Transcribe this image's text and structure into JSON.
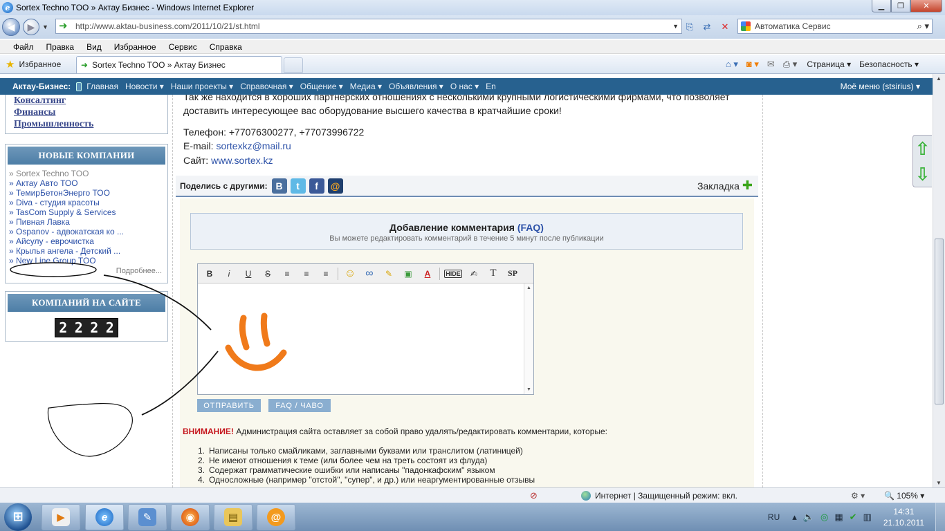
{
  "window": {
    "title": "Sortex Techno TOO » Актау Бизнес - Windows Internet Explorer",
    "min": "▁",
    "max": "❐",
    "close": "✕"
  },
  "address": {
    "url": "http://www.aktau-business.com/2011/10/21/st.html",
    "search_text": "Автоматика Сервис"
  },
  "menu": [
    "Файл",
    "Правка",
    "Вид",
    "Избранное",
    "Сервис",
    "Справка"
  ],
  "favorites": {
    "label": "Избранное",
    "tab_title": "Sortex Techno TOO » Актау Бизнес",
    "page_menu": "Страница ▾",
    "safety_menu": "Безопасность ▾"
  },
  "site_nav": {
    "brand": "Актау-Бизнес:",
    "items": [
      "Главная",
      "Новости ▾",
      "Наши проекты ▾",
      "Справочная ▾",
      "Общение ▾",
      "Медиа ▾",
      "Объявления ▾",
      "О нас ▾",
      "En"
    ],
    "my_menu": "Моё меню (stsirius) ▾"
  },
  "left": {
    "categories": [
      "Консалтинг",
      "Финансы",
      "Промышленность"
    ],
    "new_companies_title": "НОВЫЕ КОМПАНИИ",
    "companies": [
      "» Sortex Techno TOO",
      "» Актау Авто ТОО",
      "» ТемирБетонЭнерго ТОО",
      "» Diva - студия красоты",
      "» TasCom Supply & Services",
      "» Пивная Лавка",
      "» Ospanov - адвокатская ко ...",
      "» Айсулу - евpочистка",
      "» Крылья ангела - Детский ...",
      "» New Line Group TOO"
    ],
    "more": "Подробнее...",
    "count_title": "КОМПАНИЙ НА САЙТЕ",
    "count_digits": [
      "2",
      "2",
      "2",
      "2"
    ]
  },
  "main": {
    "intro_line1": "Так же находится в хороших партнерских отношениях с несколькими крупными логистическими фирмами, что позволяет",
    "intro_line2": "доставить интересующее вас оборудование высшего качества в кратчайшие сроки!",
    "phone": "Телефон: +77076300277, +77073996722",
    "email_label": "E-mail: ",
    "email": "sortexkz@mail.ru",
    "site_label": "Сайт: ",
    "site": "www.sortex.kz",
    "share_label": "Поделись с другими:",
    "social": [
      "В",
      "t",
      "f",
      "@"
    ],
    "bookmark": "Закладка",
    "add_comment_title": "Добавление комментария",
    "faq_link": "(FAQ)",
    "add_comment_sub": "Вы можете редактировать комментарий в течение 5 минут после публикации",
    "editor_buttons": [
      "B",
      "i",
      "U",
      "S",
      "≡",
      "≡",
      "≡",
      "☺",
      "∞",
      "✎",
      "▣",
      "A",
      "HIDE",
      "✍",
      "T",
      "SP"
    ],
    "submit": "ОТПРАВИТЬ",
    "faq_button": "FAQ / ЧАВО",
    "warning_label": "ВНИМАНИЕ!",
    "warning_text": " Администрация сайта оставляет за собой право удалять/редактировать комментарии, которые:",
    "rules": [
      {
        "n": "1.",
        "text": "Написаны только смайликами, заглавными буквами или транслитом (латиницей)"
      },
      {
        "n": "2.",
        "text": "Не имеют отношения к теме (или более чем на треть состоят из флуда)"
      },
      {
        "n": "3.",
        "text": "Содержат грамматические ошибки или написаны \"падонкафским\" языком"
      },
      {
        "n": "4.",
        "text": "Односложные (например \"отстой\", \"супер\", и др.) или неаргументированные отзывы"
      }
    ]
  },
  "status": {
    "zone": "Интернет | Защищенный режим: вкл.",
    "zoom": "🔍 105% ▾"
  },
  "taskbar": {
    "lang": "RU",
    "time": "14:31",
    "date": "21.10.2011"
  },
  "colors": {
    "site_nav": "#27618f",
    "box_header": "#5a89ae",
    "link": "#2c51a8",
    "warning": "#c5161d",
    "form_bg": "#f9f8ee"
  }
}
